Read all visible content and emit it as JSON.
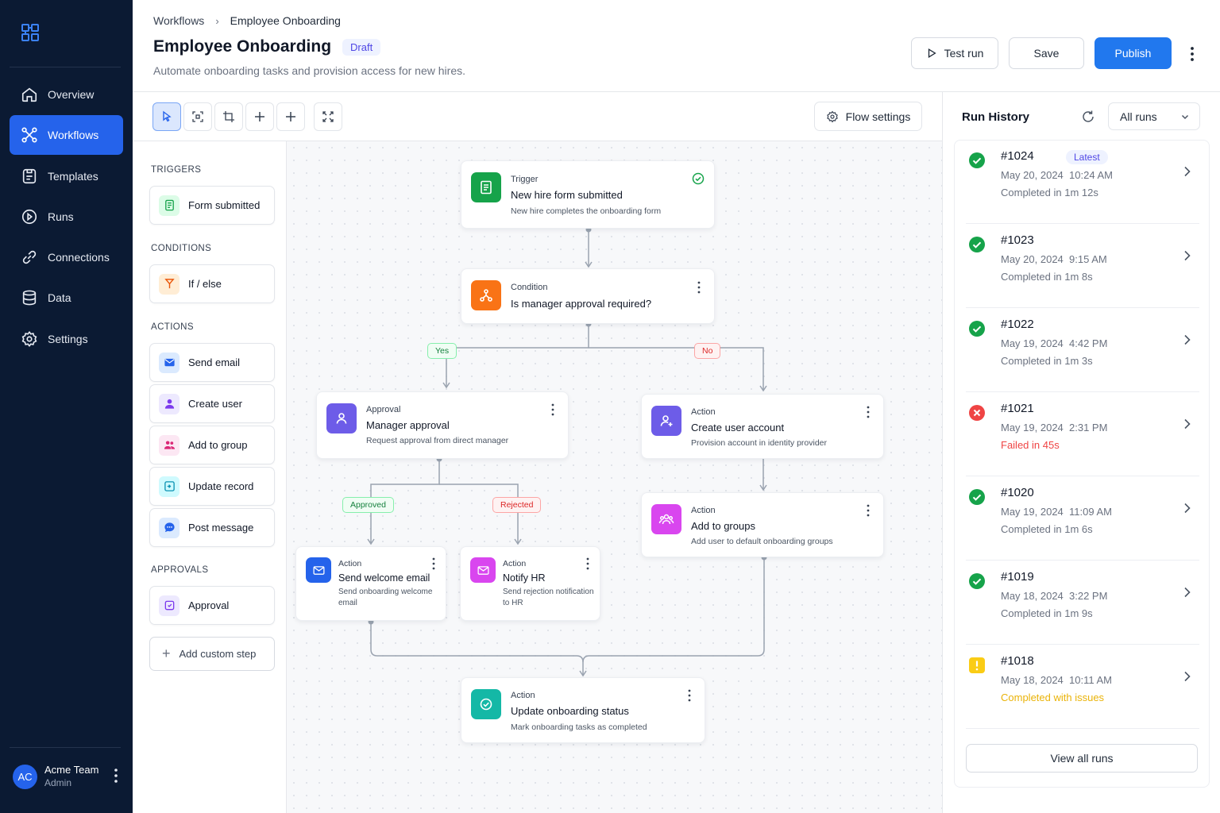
{
  "sidebar": {
    "nav": [
      {
        "label": "Overview",
        "icon": "home-icon"
      },
      {
        "label": "Workflows",
        "icon": "workflow-icon",
        "active": true
      },
      {
        "label": "Templates",
        "icon": "templates-icon"
      },
      {
        "label": "Runs",
        "icon": "play-circle-icon"
      },
      {
        "label": "Connections",
        "icon": "link-icon"
      },
      {
        "label": "Data",
        "icon": "database-icon"
      },
      {
        "label": "Settings",
        "icon": "gear-icon"
      }
    ],
    "user": {
      "initials": "AC",
      "name": "Acme Team",
      "role": "Admin"
    }
  },
  "header": {
    "breadcrumb_root": "Workflows",
    "breadcrumb_current": "Employee Onboarding",
    "title": "Employee Onboarding",
    "badge": "Draft",
    "subtitle": "Automate onboarding tasks and provision access for new hires.",
    "test_run": "Test run",
    "save": "Save",
    "publish": "Publish"
  },
  "toolbar": {
    "flow_settings": "Flow settings"
  },
  "palette": {
    "triggers_head": "TRIGGERS",
    "conditions_head": "CONDITIONS",
    "actions_head": "ACTIONS",
    "approvals_head": "APPROVALS",
    "triggers": [
      {
        "label": "Form submitted"
      }
    ],
    "conditions": [
      {
        "label": "If / else"
      }
    ],
    "actions": [
      {
        "label": "Send email"
      },
      {
        "label": "Create user"
      },
      {
        "label": "Add to group"
      },
      {
        "label": "Update record"
      },
      {
        "label": "Post message"
      }
    ],
    "approvals": [
      {
        "label": "Approval"
      }
    ],
    "add_custom": "Add custom step"
  },
  "flow": {
    "trigger": {
      "type": "Trigger",
      "title": "New hire form submitted",
      "desc": "New hire completes the onboarding form"
    },
    "condition": {
      "type": "Condition",
      "title": "Is manager approval required?"
    },
    "approval": {
      "type": "Approval",
      "title": "Manager approval",
      "desc": "Request approval from direct manager"
    },
    "create_account": {
      "type": "Action",
      "title": "Create user account",
      "desc": "Provision account in identity provider"
    },
    "add_groups": {
      "type": "Action",
      "title": "Add to groups",
      "desc": "Add user to default onboarding groups"
    },
    "welcome_email": {
      "type": "Action",
      "title": "Send welcome email",
      "desc": "Send onboarding welcome email"
    },
    "notify_hr": {
      "type": "Action",
      "title": "Notify HR",
      "desc": "Send rejection notification to HR"
    },
    "update_status": {
      "type": "Action",
      "title": "Update onboarding status",
      "desc": "Mark onboarding tasks as completed"
    },
    "labels": {
      "yes": "Yes",
      "no": "No",
      "approved": "Approved",
      "rejected": "Rejected"
    }
  },
  "runs": {
    "title": "Run History",
    "filter": "All runs",
    "latest": "Latest",
    "items": [
      {
        "id": "#1024",
        "date": "May 20, 2024",
        "time": "10:24 AM",
        "detail": "Completed in 1m 12s",
        "status": "success"
      },
      {
        "id": "#1023",
        "date": "May 20, 2024",
        "time": "9:15 AM",
        "detail": "Completed in 1m 8s",
        "status": "success"
      },
      {
        "id": "#1022",
        "date": "May 19, 2024",
        "time": "4:42 PM",
        "detail": "Completed in 1m 3s",
        "status": "success"
      },
      {
        "id": "#1021",
        "date": "May 19, 2024",
        "time": "2:31 PM",
        "detail": "Failed in 45s",
        "status": "failed"
      },
      {
        "id": "#1020",
        "date": "May 19, 2024",
        "time": "11:09 AM",
        "detail": "Completed in 1m 6s",
        "status": "success"
      },
      {
        "id": "#1019",
        "date": "May 18, 2024",
        "time": "3:22 PM",
        "detail": "Completed in 1m 9s",
        "status": "success"
      },
      {
        "id": "#1018",
        "date": "May 18, 2024",
        "time": "10:11 AM",
        "detail": "Completed with issues",
        "status": "warning"
      }
    ],
    "view_all": "View all runs"
  },
  "colors": {
    "accent": "#2563eb",
    "sidebar": "#0b1a33",
    "success": "#16a34a",
    "danger": "#ef4444",
    "warning": "#facc15"
  }
}
